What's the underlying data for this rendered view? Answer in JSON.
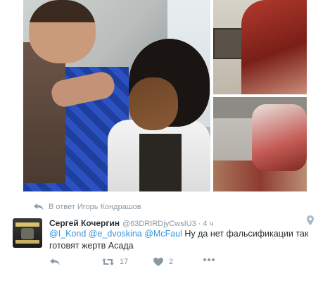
{
  "reply_context": {
    "label": "В ответ Игорь Кондрашов"
  },
  "tweet": {
    "author_name": "Сергей Кочергин",
    "author_handle": "@63DRIRDjyCwsIU3",
    "separator": "·",
    "time": "4 ч",
    "mentions": [
      "@I_Kond",
      "@e_dvoskina",
      "@McFaul"
    ],
    "text": "Ну да нет фальсификации так готовят жертв Асада",
    "icons": {
      "reply": "reply-arrow-icon",
      "retweet": "retweet-icon",
      "like": "heart-icon",
      "more": "more-dots-icon",
      "geo": "location-pin-icon"
    }
  },
  "stats": {
    "retweets": "17",
    "likes": "2"
  },
  "colors": {
    "link": "#3b94d9",
    "muted": "#8899a6",
    "text": "#292f33"
  }
}
